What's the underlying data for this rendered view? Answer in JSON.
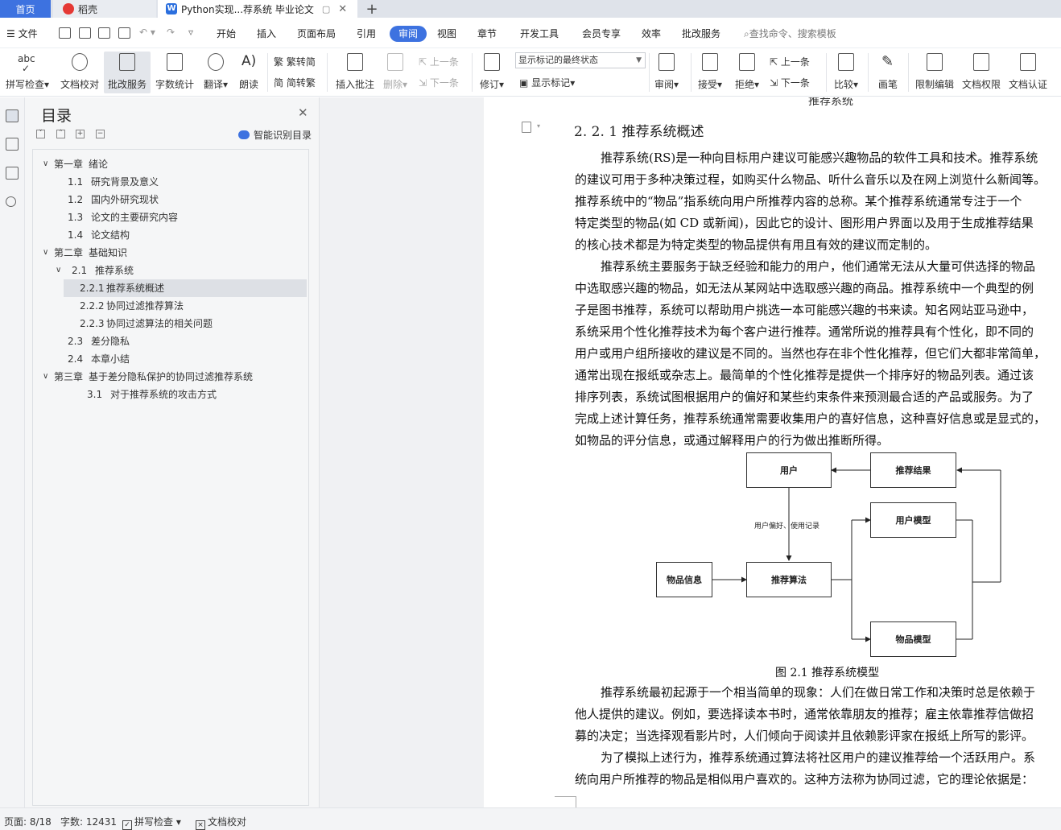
{
  "tabs": {
    "home": "首页",
    "daoke": "稻壳",
    "document": "Python实现...荐系统 毕业论文",
    "add": "+"
  },
  "menu": {
    "file": "文件",
    "items": [
      "开始",
      "插入",
      "页面布局",
      "引用",
      "审阅",
      "视图",
      "章节",
      "开发工具",
      "会员专享",
      "效率",
      "批改服务"
    ],
    "active": "审阅",
    "search_placeholder": "查找命令、搜索模板"
  },
  "ribbon": {
    "spell_check": "拼写检查",
    "doc_proof": "文档校对",
    "correction_service": "批改服务",
    "word_count": "字数统计",
    "translate": "翻译",
    "read_aloud": "朗读",
    "to_traditional": "繁转简",
    "to_simplified": "简转繁",
    "insert_comment": "插入批注",
    "delete": "删除",
    "prev_comment": "上一条",
    "next_comment": "下一条",
    "track_changes": "修订",
    "markup_mode": "显示标记的最终状态",
    "show_markup": "显示标记",
    "review": "审阅",
    "accept": "接受",
    "reject": "拒绝",
    "prev_change": "上一条",
    "next_change": "下一条",
    "compare": "比较",
    "ink": "画笔",
    "restrict_editing": "限制编辑",
    "doc_permissions": "文档权限",
    "doc_certification": "文档认证"
  },
  "toc": {
    "title": "目录",
    "smart_toc": "智能识别目录",
    "items": [
      {
        "num": "第一章",
        "text": "绪论"
      },
      {
        "num": "1.1",
        "text": "研究背景及意义"
      },
      {
        "num": "1.2",
        "text": "国内外研究现状"
      },
      {
        "num": "1.3",
        "text": "论文的主要研究内容"
      },
      {
        "num": "1.4",
        "text": "论文结构"
      },
      {
        "num": "第二章",
        "text": "基础知识"
      },
      {
        "num": "2.1",
        "text": "推荐系统"
      },
      {
        "num": "2.2.1",
        "text": "推荐系统概述"
      },
      {
        "num": "2.2.2",
        "text": "协同过滤推荐算法"
      },
      {
        "num": "2.2.3",
        "text": "协同过滤算法的相关问题"
      },
      {
        "num": "2.3",
        "text": "差分隐私"
      },
      {
        "num": "2.4",
        "text": "本章小结"
      },
      {
        "num": "第三章",
        "text": "基于差分隐私保护的协同过滤推荐系统"
      },
      {
        "num": "3.1",
        "text": "对于推荐系统的攻击方式"
      }
    ]
  },
  "document": {
    "top_cut": "推荐系统",
    "heading": "2. 2. 1  推荐系统概述",
    "para1": [
      "推荐系统(RS)是一种向目标用户建议可能感兴趣物品的软件工具和技术。推荐系统",
      "的建议可用于多种决策过程，如购买什么物品、听什么音乐以及在网上浏览什么新闻等。",
      "推荐系统中的“物品”指系统向用户所推荐内容的总称。某个推荐系统通常专注于一个",
      "特定类型的物品(如 CD 或新闻)，因此它的设计、图形用户界面以及用于生成推荐结果",
      "的核心技术都是为特定类型的物品提供有用且有效的建议而定制的。"
    ],
    "para2": [
      "推荐系统主要服务于缺乏经验和能力的用户，他们通常无法从大量可供选择的物品",
      "中选取感兴趣的物品，如无法从某网站中选取感兴趣的商品。推荐系统中一个典型的例",
      "子是图书推荐，系统可以帮助用户挑选一本可能感兴趣的书来读。知名网站亚马逊中，",
      "系统采用个性化推荐技术为每个客户进行推荐。通常所说的推荐具有个性化，即不同的",
      "用户或用户组所接收的建议是不同的。当然也存在非个性化推荐，但它们大都非常简单，",
      "通常出现在报纸或杂志上。最简单的个性化推荐是提供一个排序好的物品列表。通过该",
      "排序列表，系统试图根据用户的偏好和某些约束条件来预测最合适的产品或服务。为了",
      "完成上述计算任务，推荐系统通常需要收集用户的喜好信息，这种喜好信息或是显式的，",
      "如物品的评分信息，或通过解释用户的行为做出推断所得。"
    ],
    "diagram": {
      "user": "用户",
      "result": "推荐结果",
      "user_model": "用户模型",
      "item_info": "物品信息",
      "algorithm": "推荐算法",
      "item_model": "物品模型",
      "edge_label": "用户偏好、使用记录"
    },
    "caption": "图 2.1   推荐系统模型",
    "para3": [
      "推荐系统最初起源于一个相当简单的现象：人们在做日常工作和决策时总是依赖于",
      "他人提供的建议。例如，要选择读本书时，通常依靠朋友的推荐；雇主依靠推荐信做招",
      "募的决定；当选择观看影片时，人们倾向于阅读并且依赖影评家在报纸上所写的影评。"
    ],
    "para4": [
      "为了模拟上述行为，推荐系统通过算法将社区用户的建议推荐给一个活跃用户。系",
      "统向用户所推荐的物品是相似用户喜欢的。这种方法称为协同过滤，它的理论依据是："
    ]
  },
  "status": {
    "page": "页面: 8/18",
    "words": "字数: 12431",
    "spell_check": "拼写检查",
    "doc_proof": "文档校对"
  },
  "colors": {
    "accent": "#3d72e0",
    "tab_bar": "#dfe3ea",
    "toc_selected": "#dde0e5"
  }
}
